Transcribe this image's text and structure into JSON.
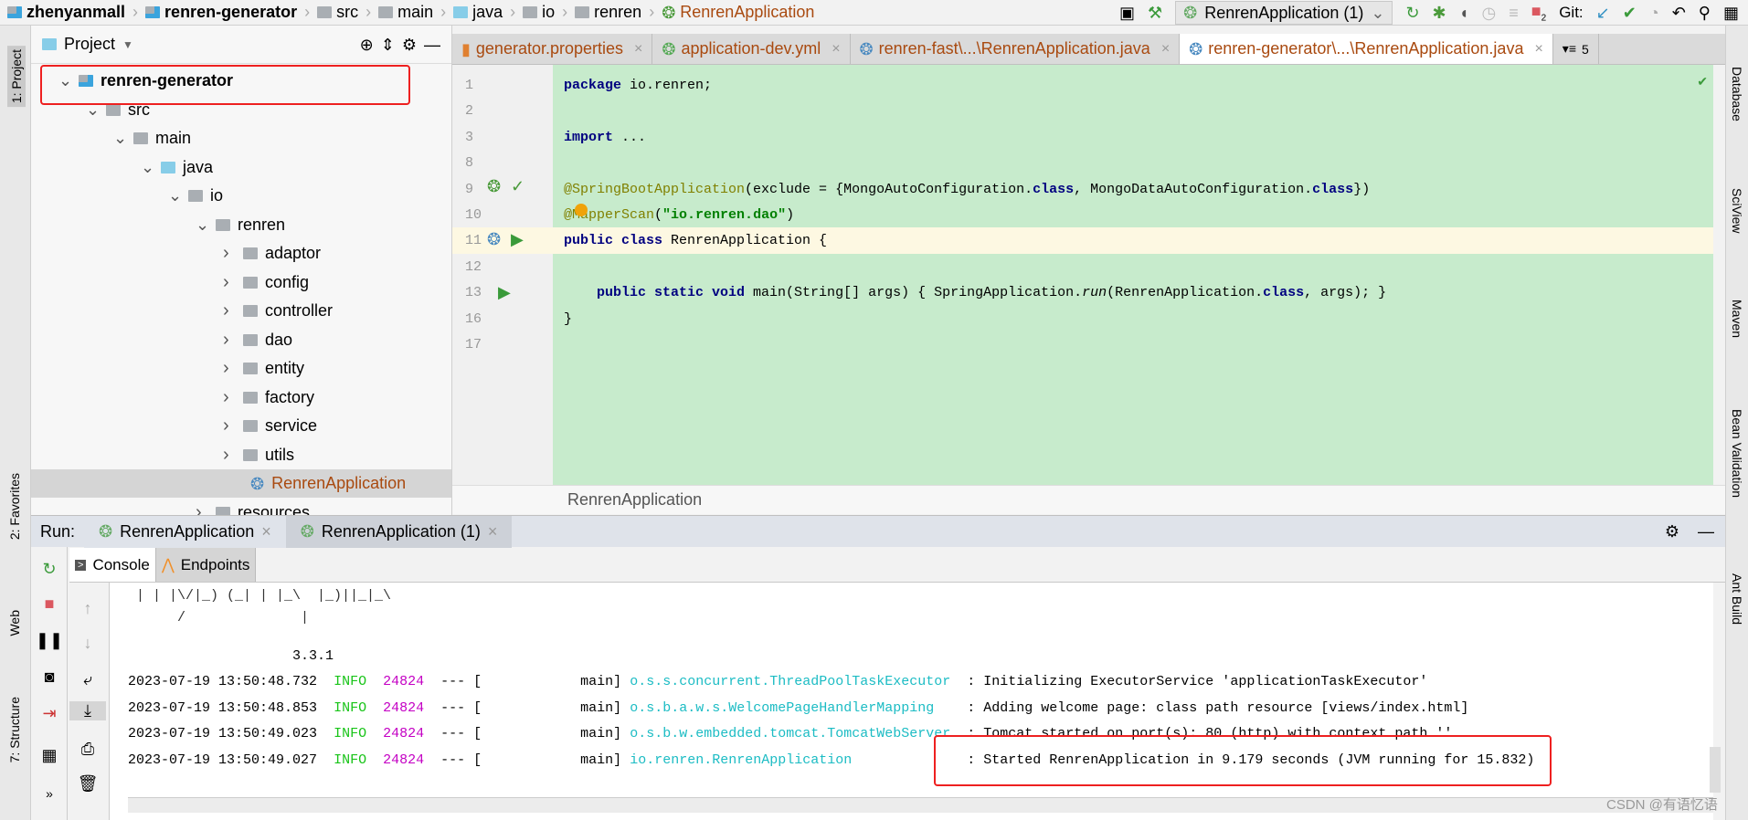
{
  "breadcrumb": [
    "zhenyanmall",
    "renren-generator",
    "src",
    "main",
    "java",
    "io",
    "renren",
    "RenrenApplication"
  ],
  "toolbar": {
    "run_config": "RenrenApplication (1)",
    "git_label": "Git:",
    "stop_badge": "2"
  },
  "left_strip": {
    "project": "1: Project",
    "favorites": "2: Favorites",
    "web": "Web",
    "structure": "7: Structure"
  },
  "right_strip": [
    "Database",
    "SciView",
    "Maven",
    "Bean Validation",
    "Ant Build"
  ],
  "project_panel": {
    "title": "Project",
    "tree": [
      {
        "label": "renren-generator",
        "expanded": true
      },
      {
        "label": "src",
        "expanded": true
      },
      {
        "label": "main",
        "expanded": true
      },
      {
        "label": "java",
        "expanded": true
      },
      {
        "label": "io",
        "expanded": true
      },
      {
        "label": "renren",
        "expanded": true
      },
      {
        "label": "adaptor"
      },
      {
        "label": "config"
      },
      {
        "label": "controller"
      },
      {
        "label": "dao"
      },
      {
        "label": "entity"
      },
      {
        "label": "factory"
      },
      {
        "label": "service"
      },
      {
        "label": "utils"
      },
      {
        "label": "RenrenApplication",
        "selected": true
      },
      {
        "label": "resources"
      }
    ]
  },
  "editor": {
    "tabs": [
      "generator.properties",
      "application-dev.yml",
      "renren-fast\\...\\RenrenApplication.java",
      "renren-generator\\...\\RenrenApplication.java"
    ],
    "active_tab": 3,
    "tab_overflow": "5",
    "line_numbers": [
      "1",
      "2",
      "3",
      "8",
      "9",
      "10",
      "11",
      "12",
      "13",
      "16",
      "17"
    ],
    "lines": {
      "l1_kw": "package",
      "l1_rest": " io.renren;",
      "l3_kw": "import",
      "l3_rest": " ...",
      "l9_ann": "@SpringBootApplication",
      "l9_a": "(exclude = {MongoAutoConfiguration.",
      "l9_k1": "class",
      "l9_b": ", MongoDataAutoConfiguration.",
      "l9_k2": "class",
      "l9_c": "})",
      "l10_ann": "@MapperScan",
      "l10_a": "(",
      "l10_str": "\"io.renren.dao\"",
      "l10_b": ")",
      "l11_kw": "public class",
      "l11_rest": " RenrenApplication {",
      "l13_kw": "public static void",
      "l13_a": " main(String[] args) { SpringApplication.",
      "l13_run": "run",
      "l13_b": "(RenrenApplication.",
      "l13_k": "class",
      "l13_c": ", args); }",
      "l16": "}"
    },
    "breadcrumb": "RenrenApplication"
  },
  "run_panel": {
    "label": "Run:",
    "tabs": [
      "RenrenApplication",
      "RenrenApplication (1)"
    ],
    "subtabs": [
      "Console",
      "Endpoints"
    ]
  },
  "console": {
    "banner": [
      " | | |\\/|_) (_| | |_\\  |_)||_|_\\",
      "      /              |",
      "                    3.3.1"
    ],
    "logs": [
      {
        "ts": "2023-07-19 13:50:48.732",
        "level": "INFO",
        "pid": "24824",
        "sep": "--- [",
        "thread": "          main]",
        "logger": "o.s.s.concurrent.ThreadPoolTaskExecutor  ",
        "msg": ": Initializing ExecutorService 'applicationTaskExecutor'"
      },
      {
        "ts": "2023-07-19 13:50:48.853",
        "level": "INFO",
        "pid": "24824",
        "sep": "--- [",
        "thread": "          main]",
        "logger": "o.s.b.a.w.s.WelcomePageHandlerMapping    ",
        "msg": ": Adding welcome page: class path resource [views/index.html]"
      },
      {
        "ts": "2023-07-19 13:50:49.023",
        "level": "INFO",
        "pid": "24824",
        "sep": "--- [",
        "thread": "          main]",
        "logger": "o.s.b.w.embedded.tomcat.TomcatWebServer  ",
        "msg": ": Tomcat started on port(s): 80 (http) with context path ''"
      },
      {
        "ts": "2023-07-19 13:50:49.027",
        "level": "INFO",
        "pid": "24824",
        "sep": "--- [",
        "thread": "          main]",
        "logger": "io.renren.RenrenApplication              ",
        "msg": ": Started RenrenApplication in 9.179 seconds (JVM running for 15.832)"
      }
    ]
  },
  "watermark": "CSDN @有语忆语",
  "colors": {
    "highlight_box": "#ee2020",
    "code_bg": "#c7ebcc",
    "info": "#19c419",
    "pid": "#c400c4",
    "logger": "#1cbcc4"
  }
}
